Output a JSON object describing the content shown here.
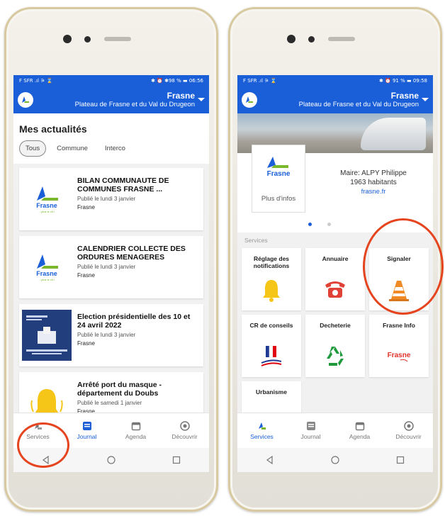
{
  "left": {
    "status": {
      "left": "F SFR .ıl ⚞ ⌛",
      "right": "✱ ⏰ ✱98 % ▬ 06:56"
    },
    "header": {
      "title": "Frasne",
      "subtitle": "Plateau de Frasne et du Val du Drugeon"
    },
    "section_title": "Mes actualités",
    "chips": [
      {
        "label": "Tous"
      },
      {
        "label": "Commune"
      },
      {
        "label": "Interco"
      }
    ],
    "cards": [
      {
        "title": "BILAN COMMUNAUTE DE COMMUNES FRASNE ...",
        "date": "Publié le lundi 3 janvier",
        "source": "Frasne"
      },
      {
        "title": "CALENDRIER COLLECTE DES ORDURES MENAGERES",
        "date": "Publié le lundi 3 janvier",
        "source": "Frasne"
      },
      {
        "title": "Election présidentielle des 10 et 24 avril 2022",
        "date": "Publié le lundi 3 janvier",
        "source": "Frasne"
      },
      {
        "title": "Arrêté port du masque - département du Doubs",
        "date": "Publié le samedi 1 janvier",
        "source": "Frasne"
      }
    ],
    "nav": [
      {
        "label": "Services"
      },
      {
        "label": "Journal"
      },
      {
        "label": "Agenda"
      },
      {
        "label": "Découvrir"
      }
    ]
  },
  "right": {
    "status": {
      "left": "F SFR .ıl ⚞ ⌛",
      "right": "✱ ⏰ 91 % ▬ 09:58"
    },
    "header": {
      "title": "Frasne",
      "subtitle": "Plateau de Frasne et du Val du Drugeon"
    },
    "logo_text": "Frasne",
    "logo_tag": "...plus le vit !",
    "plus_infos": "Plus d'infos",
    "mayor": "Maire: ALPY Philippe",
    "population": "1963 habitants",
    "website": "frasne.fr",
    "services_label": "Services",
    "tiles": [
      {
        "label": "Réglage des notifications",
        "icon": "bell-icon"
      },
      {
        "label": "Annuaire",
        "icon": "phone-icon"
      },
      {
        "label": "Signaler",
        "icon": "traffic-cone-icon"
      },
      {
        "label": "CR de conseils",
        "icon": "republique-logo-icon"
      },
      {
        "label": "Decheterie",
        "icon": "recycle-icon"
      },
      {
        "label": "Frasne Info",
        "icon": "frasne-logo-icon"
      },
      {
        "label": "Urbanisme",
        "icon": "globe-icon"
      }
    ],
    "nav": [
      {
        "label": "Services"
      },
      {
        "label": "Journal"
      },
      {
        "label": "Agenda"
      },
      {
        "label": "Découvrir"
      }
    ]
  },
  "colors": {
    "brand_blue": "#1a5fd8",
    "highlight_red": "#e5441e",
    "bell_yellow": "#f5c518",
    "cone_orange": "#f08a24"
  }
}
